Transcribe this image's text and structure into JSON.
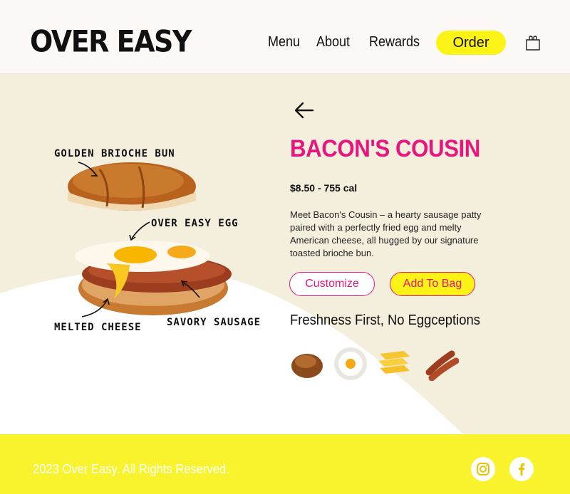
{
  "brand": {
    "logo_text": "OVER EASY"
  },
  "nav": {
    "links": [
      {
        "label": "Menu"
      },
      {
        "label": "About"
      },
      {
        "label": "Rewards"
      }
    ],
    "order_label": "Order",
    "bag_icon": "shopping-bag-icon"
  },
  "illustration": {
    "callouts": {
      "bun": "GOLDEN BRIOCHE BUN",
      "egg": "OVER EASY EGG",
      "cheese": "MELTED CHEESE",
      "sausage": "SAVORY SAUSAGE"
    }
  },
  "product": {
    "back_icon": "arrow-left-icon",
    "name": "BACON'S COUSIN",
    "price_cal": "$8.50 - 755 cal",
    "description": "Meet Bacon's Cousin – a hearty sausage patty paired with a perfectly fried egg and melty American cheese, all hugged by our signature toasted brioche bun.",
    "customize_label": "Customize",
    "add_to_bag_label": "Add To Bag",
    "tagline": "Freshness First, No Eggceptions",
    "ingredients": [
      "brioche-bun-icon",
      "fried-egg-icon",
      "cheese-slices-icon",
      "sausage-icon"
    ]
  },
  "footer": {
    "copyright": "2023 Over Easy. All Rights Reserved.",
    "social": [
      "instagram-icon",
      "facebook-icon"
    ]
  },
  "colors": {
    "accent_pink": "#e6167e",
    "accent_yellow": "#fbf216",
    "cream": "#f4eedd",
    "footer_yellow": "#f9f32d"
  }
}
